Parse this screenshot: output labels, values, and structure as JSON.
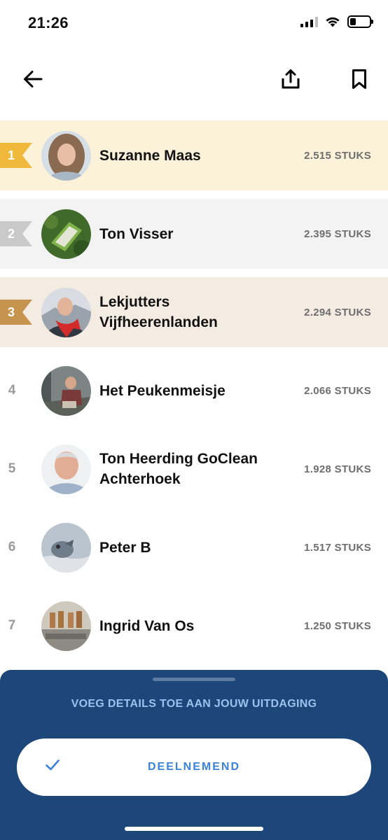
{
  "status_bar": {
    "time": "21:26",
    "signal_icon": "cellular-signal-icon",
    "wifi_icon": "wifi-icon",
    "battery_icon": "battery-icon",
    "battery_level": 0.25
  },
  "nav": {
    "back_icon": "arrow-left-icon",
    "share_icon": "share-upload-icon",
    "bookmark_icon": "bookmark-icon"
  },
  "leaderboard": [
    {
      "rank": "1",
      "name": "Suzanne Maas",
      "count": "2.515 STUKS",
      "medal": "gold"
    },
    {
      "rank": "2",
      "name": "Ton Visser",
      "count": "2.395 STUKS",
      "medal": "silver"
    },
    {
      "rank": "3",
      "name": "Lekjutters Vijfheerenlanden",
      "count": "2.294 STUKS",
      "medal": "bronze"
    },
    {
      "rank": "4",
      "name": "Het Peukenmeisje",
      "count": "2.066 STUKS"
    },
    {
      "rank": "5",
      "name": "Ton Heerding GoClean Achterhoek",
      "count": "1.928 STUKS"
    },
    {
      "rank": "6",
      "name": "Peter B",
      "count": "1.517 STUKS"
    },
    {
      "rank": "7",
      "name": "Ingrid Van Os",
      "count": "1.250 STUKS"
    }
  ],
  "colors": {
    "gold": "#f0b93c",
    "silver": "#c9c9c9",
    "bronze": "#c79450",
    "sheet_bg": "#1d4679",
    "accent_blue": "#3b82d8"
  },
  "sheet": {
    "details_link": "VOEG DETAILS TOE AAN JOUW UITDAGING",
    "join_label": "DEELNEMEND",
    "check_icon": "checkmark-icon"
  }
}
